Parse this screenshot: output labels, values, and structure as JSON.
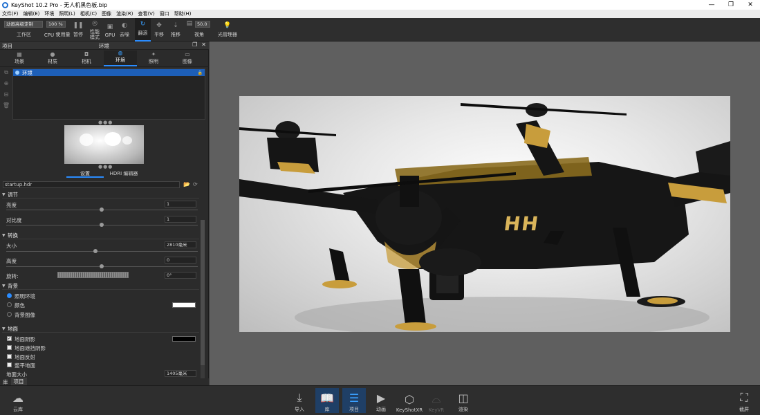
{
  "window": {
    "title": "KeyShot 10.2 Pro  - 无人机黑色板.bip"
  },
  "menu": [
    "文件(F)",
    "编辑(E)",
    "环境",
    "照明(L)",
    "相机(C)",
    "图像",
    "渲染(R)",
    "查看(V)",
    "窗口",
    "帮助(H)"
  ],
  "toolbar": {
    "workspace_value": "动画高级定制",
    "workspace_label": "工作区",
    "cpu_pct": "100 %",
    "fov_value": "50.0",
    "items": {
      "cpu": "CPU",
      "usage": "使用量",
      "pause": "暂停",
      "perf": "性能模式",
      "gpu": "GPU",
      "denoise": "去噪",
      "tumble": "翻滚",
      "pan": "平移",
      "dolly": "推移",
      "fov": "视角",
      "light_mgr": "光管理器"
    }
  },
  "panel": {
    "header_left": "项目",
    "header_title": "环境",
    "tabs": [
      "场景",
      "材质",
      "相机",
      "环境",
      "照明",
      "图像"
    ],
    "env_item": "环境",
    "subtabs": {
      "settings": "设置",
      "hdri_editor": "HDRI 编辑器"
    },
    "file": "startup.hdr",
    "sections": {
      "adjust": "调节",
      "transform": "转换",
      "background": "背景",
      "ground": "地面"
    },
    "props": {
      "brightness_label": "亮度",
      "brightness_value": "1",
      "contrast_label": "对比度",
      "contrast_value": "1",
      "size_label": "大小",
      "size_value": "2810毫米",
      "height_label": "高度",
      "height_value": "0",
      "rotation_label": "旋转:",
      "rotation_value": "0°",
      "ground_size_label": "地面大小",
      "ground_size_value": "1405毫米"
    },
    "background_options": [
      "照明环境",
      "颜色",
      "背景图像"
    ],
    "ground_options": [
      "地面阴影",
      "地面遮挡阴影",
      "地面反射",
      "整平地面"
    ],
    "bottom_tabs": [
      "库",
      "项目"
    ],
    "colors": {
      "bg_color": "#ffffff",
      "shadow_color": "#000000"
    }
  },
  "ribbon": {
    "cloud": "云库",
    "import": "导入",
    "library": "库",
    "project": "项目",
    "animation": "动画",
    "keyshotxr": "KeyShotXR",
    "keyvr": "KeyVR",
    "render": "渲染",
    "screenshot": "截屏"
  },
  "render": {
    "logo_text": "HH"
  }
}
